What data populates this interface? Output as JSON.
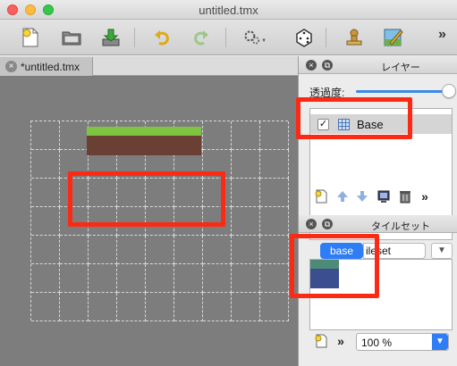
{
  "window": {
    "title": "untitled.tmx"
  },
  "toolbar": {
    "more": "»"
  },
  "document": {
    "tab_label": "*untitled.tmx",
    "tab_close": "×"
  },
  "layers_panel": {
    "title": "レイヤー",
    "opacity_label": "透過度:",
    "opacity_value": 1.0,
    "layers": [
      {
        "name": "Base",
        "visible": true
      }
    ],
    "more": "»"
  },
  "tileset_panel": {
    "title": "タイルセット",
    "tabs": [
      "base",
      "ileset"
    ],
    "dropdown": "▼",
    "more": "»",
    "zoom": "100 %"
  },
  "colors": {
    "highlight": "#fb2a14",
    "grass": "#7fc440",
    "dirt": "#6a3f34",
    "accent": "#2f7df6"
  }
}
